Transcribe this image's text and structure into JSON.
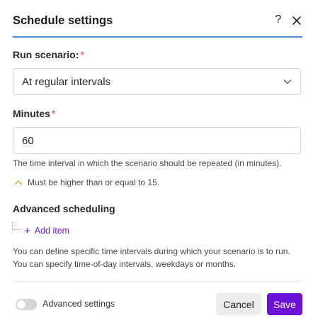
{
  "dialog": {
    "title": "Schedule settings",
    "help_label": "?"
  },
  "run_scenario": {
    "label": "Run scenario:",
    "required_mark": "*",
    "value": "At regular intervals"
  },
  "minutes": {
    "label": "Minutes",
    "required_mark": "*",
    "value": "60",
    "help": "The time interval in which the scenario should be repeated (in minutes).",
    "warning": "Must be higher than or equal to 15."
  },
  "advanced_scheduling": {
    "label": "Advanced scheduling",
    "add_plus": "+",
    "add_label": "Add item",
    "help": "You can define specific time intervals during which your scenario is to run. You can specify time-of-day intervals, weekdays or months."
  },
  "footer": {
    "toggle_label": "Advanced settings",
    "toggle_on": false,
    "cancel_label": "Cancel",
    "save_label": "Save"
  },
  "colors": {
    "accent": "#6b12d6",
    "header_rule": "#4a8fd6",
    "required": "#e0303a",
    "warning": "#e6a52a"
  }
}
